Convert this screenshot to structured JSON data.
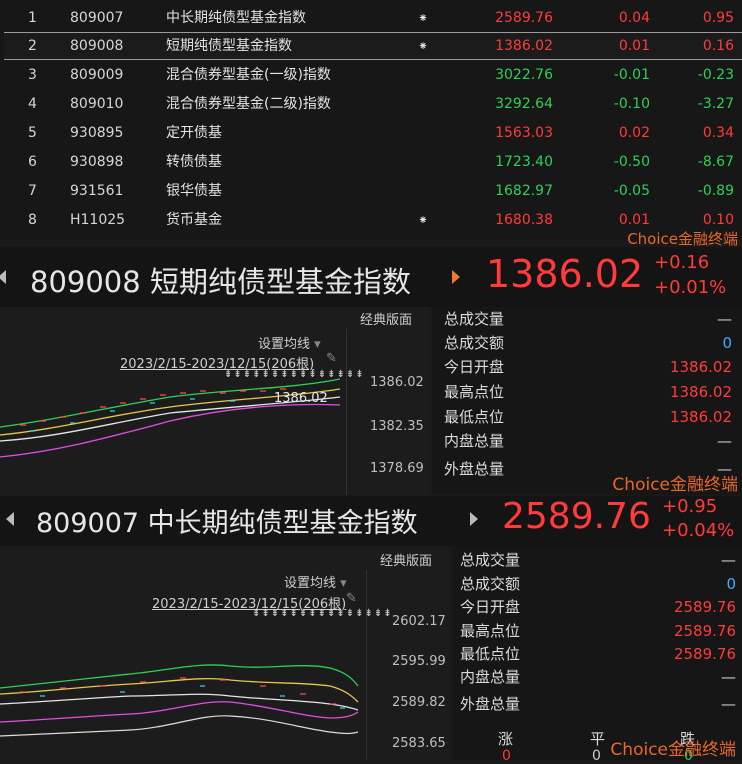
{
  "table": {
    "rows": [
      {
        "idx": "1",
        "code": "809007",
        "name": "中长期纯债型基金指数",
        "star": "⁕",
        "price": "2589.76",
        "chg": "0.04",
        "pct": "0.95",
        "color": "red"
      },
      {
        "idx": "2",
        "code": "809008",
        "name": "短期纯债型基金指数",
        "star": "⁕",
        "price": "1386.02",
        "chg": "0.01",
        "pct": "0.16",
        "color": "red"
      },
      {
        "idx": "3",
        "code": "809009",
        "name": "混合债券型基金(一级)指数",
        "star": "",
        "price": "3022.76",
        "chg": "-0.01",
        "pct": "-0.23",
        "color": "green"
      },
      {
        "idx": "4",
        "code": "809010",
        "name": "混合债券型基金(二级)指数",
        "star": "",
        "price": "3292.64",
        "chg": "-0.10",
        "pct": "-3.27",
        "color": "green"
      },
      {
        "idx": "5",
        "code": "930895",
        "name": "定开债基",
        "star": "",
        "price": "1563.03",
        "chg": "0.02",
        "pct": "0.34",
        "color": "red"
      },
      {
        "idx": "6",
        "code": "930898",
        "name": "转债债基",
        "star": "",
        "price": "1723.40",
        "chg": "-0.50",
        "pct": "-8.67",
        "color": "green"
      },
      {
        "idx": "7",
        "code": "931561",
        "name": "银华债基",
        "star": "",
        "price": "1682.97",
        "chg": "-0.05",
        "pct": "-0.89",
        "color": "green"
      },
      {
        "idx": "8",
        "code": "H11025",
        "name": "货币基金",
        "star": "⁕",
        "price": "1680.38",
        "chg": "0.01",
        "pct": "0.10",
        "color": "red"
      }
    ],
    "brand": "Choice金融终端"
  },
  "panel1": {
    "code": "809008",
    "name": "短期纯债型基金指数",
    "price": "1386.02",
    "chg": "+0.16",
    "pct": "+0.01%",
    "classic": "经典版面",
    "ma_setting": "设置均线",
    "range": "2023/2/15-2023/12/15(206根)",
    "yticks": [
      "1386.02",
      "1382.35",
      "1378.69"
    ],
    "last_label": "1386.02",
    "side": [
      {
        "label": "总成交量",
        "value": "—",
        "kind": "dash"
      },
      {
        "label": "总成交额",
        "value": "0",
        "kind": "zero"
      },
      {
        "label": "今日开盘",
        "value": "1386.02",
        "kind": "red"
      },
      {
        "label": "最高点位",
        "value": "1386.02",
        "kind": "red"
      },
      {
        "label": "最低点位",
        "value": "1386.02",
        "kind": "red"
      },
      {
        "label": "内盘总量",
        "value": "—",
        "kind": "dash"
      },
      {
        "label": "外盘总量",
        "value": "—",
        "kind": "dash"
      }
    ],
    "brand": "Choice金融终端"
  },
  "panel2": {
    "code": "809007",
    "name": "中长期纯债型基金指数",
    "price": "2589.76",
    "chg": "+0.95",
    "pct": "+0.04%",
    "classic": "经典版面",
    "ma_setting": "设置均线",
    "range": "2023/2/15-2023/12/15(206根)",
    "yticks": [
      "2602.17",
      "2595.99",
      "2589.82",
      "2583.65"
    ],
    "side": [
      {
        "label": "总成交量",
        "value": "—",
        "kind": "dash"
      },
      {
        "label": "总成交额",
        "value": "0",
        "kind": "zero"
      },
      {
        "label": "今日开盘",
        "value": "2589.76",
        "kind": "red"
      },
      {
        "label": "最高点位",
        "value": "2589.76",
        "kind": "red"
      },
      {
        "label": "最低点位",
        "value": "2589.76",
        "kind": "red"
      },
      {
        "label": "内盘总量",
        "value": "—",
        "kind": "dash"
      },
      {
        "label": "外盘总量",
        "value": "—",
        "kind": "dash"
      }
    ],
    "bottom": {
      "up": "涨",
      "flat": "平",
      "down": "跌",
      "up_val": "0",
      "flat_val": "0",
      "down_val": "0"
    },
    "brand": "Choice金融终端"
  },
  "colors": {
    "red": "#ff3b3b",
    "green": "#2fcf58",
    "brand": "#e8672e",
    "zero": "#36b3ff"
  }
}
